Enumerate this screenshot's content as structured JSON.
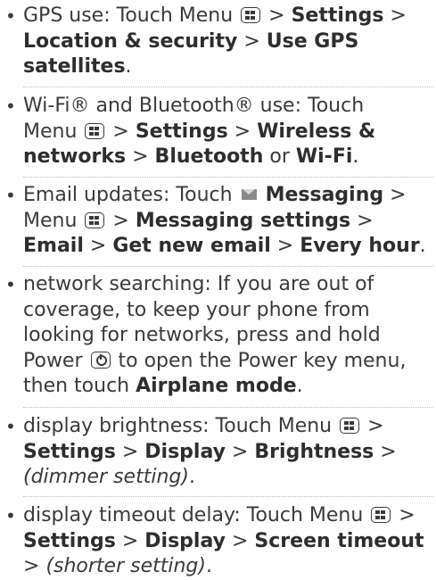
{
  "items": [
    {
      "id": "gps",
      "lines": [
        [
          {
            "t": "GPS use: Touch Menu "
          },
          {
            "icon": "menu-key"
          },
          {
            "t": " > "
          },
          {
            "b": "Settings"
          },
          {
            "t": " >"
          }
        ],
        [
          {
            "b": "Location & security"
          },
          {
            "t": " > "
          },
          {
            "b": "Use GPS"
          }
        ],
        [
          {
            "b": "satellites"
          },
          {
            "t": "."
          }
        ]
      ]
    },
    {
      "id": "wifi",
      "lines": [
        [
          {
            "t": "Wi-Fi® and Bluetooth® use: Touch"
          }
        ],
        [
          {
            "t": "Menu "
          },
          {
            "icon": "menu-key"
          },
          {
            "t": " > "
          },
          {
            "b": "Settings"
          },
          {
            "t": " > "
          },
          {
            "b": "Wireless &"
          }
        ],
        [
          {
            "b": "networks"
          },
          {
            "t": " > "
          },
          {
            "b": "Bluetooth"
          },
          {
            "t": " or "
          },
          {
            "b": "Wi-Fi"
          },
          {
            "t": "."
          }
        ]
      ]
    },
    {
      "id": "email",
      "lines": [
        [
          {
            "t": "Email updates: Touch "
          },
          {
            "icon": "envelope"
          },
          {
            "t": " "
          },
          {
            "b": "Messaging"
          },
          {
            "t": " >"
          }
        ],
        [
          {
            "t": "Menu "
          },
          {
            "icon": "menu-key"
          },
          {
            "t": " > "
          },
          {
            "b": "Messaging settings"
          },
          {
            "t": " >"
          }
        ],
        [
          {
            "b": "Email"
          },
          {
            "t": " > "
          },
          {
            "b": "Get new email"
          },
          {
            "t": " > "
          },
          {
            "b": "Every hour"
          },
          {
            "t": "."
          }
        ]
      ]
    },
    {
      "id": "network",
      "lines": [
        [
          {
            "t": "network searching: If you are out of"
          }
        ],
        [
          {
            "t": "coverage, to keep your phone from"
          }
        ],
        [
          {
            "t": "looking for networks, press and hold"
          }
        ],
        [
          {
            "t": "Power "
          },
          {
            "icon": "power-key"
          },
          {
            "t": " to open the Power key menu,"
          }
        ],
        [
          {
            "t": "then touch "
          },
          {
            "b": "Airplane mode"
          },
          {
            "t": "."
          }
        ]
      ]
    },
    {
      "id": "brightness",
      "lines": [
        [
          {
            "t": "display brightness: Touch Menu "
          },
          {
            "icon": "menu-key"
          },
          {
            "t": " >"
          }
        ],
        [
          {
            "b": "Settings"
          },
          {
            "t": " > "
          },
          {
            "b": "Display"
          },
          {
            "t": " > "
          },
          {
            "b": "Brightness"
          },
          {
            "t": " >"
          }
        ],
        [
          {
            "i": "(dimmer setting)"
          },
          {
            "t": "."
          }
        ]
      ]
    },
    {
      "id": "timeout",
      "lines": [
        [
          {
            "t": "display timeout delay: Touch Menu "
          },
          {
            "icon": "menu-key"
          },
          {
            "t": " >"
          }
        ],
        [
          {
            "b": "Settings"
          },
          {
            "t": " > "
          },
          {
            "b": "Display"
          },
          {
            "t": " > "
          },
          {
            "b": "Screen timeout"
          }
        ],
        [
          {
            "t": "> "
          },
          {
            "i": "(shorter setting)"
          },
          {
            "t": "."
          }
        ]
      ]
    }
  ]
}
